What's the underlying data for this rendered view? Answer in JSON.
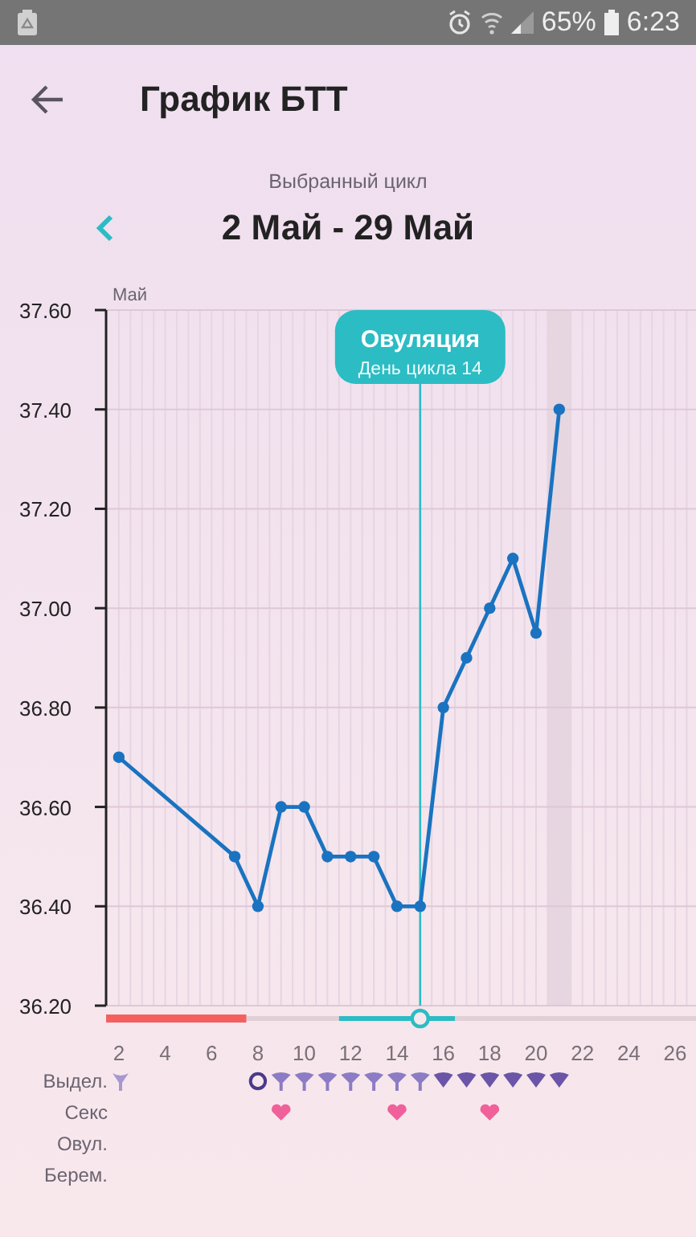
{
  "status_bar": {
    "battery": "65%",
    "time": "6:23"
  },
  "header": {
    "title": "График БТТ"
  },
  "cycle": {
    "caption": "Выбранный цикл",
    "range": "2 Май - 29 Май"
  },
  "chart": {
    "month_label": "Май",
    "ovulation_bubble": {
      "title": "Овуляция",
      "subtitle": "День цикла 14"
    },
    "chart_data": {
      "type": "line",
      "grid": true,
      "x": [
        2,
        7,
        8,
        9,
        10,
        11,
        12,
        13,
        14,
        15,
        16,
        17,
        18,
        19,
        20,
        21
      ],
      "series": [
        {
          "color": "#1a73c0",
          "marker": "o",
          "values": [
            36.7,
            36.5,
            36.4,
            36.6,
            36.6,
            36.5,
            36.5,
            36.5,
            36.4,
            36.4,
            36.8,
            36.9,
            37.0,
            37.1,
            36.95,
            37.4
          ]
        }
      ],
      "xlim": [
        1.45,
        26.9
      ],
      "ylim": [
        36.2,
        37.6
      ],
      "xticks": [
        2,
        4,
        6,
        8,
        10,
        12,
        14,
        16,
        18,
        20,
        22,
        24,
        26
      ],
      "yticks": [
        {
          "value": 36.2,
          "label": "36.20"
        },
        {
          "value": 36.4,
          "label": "36.40"
        },
        {
          "value": 36.6,
          "label": "36.60"
        },
        {
          "value": 36.8,
          "label": "36.80"
        },
        {
          "value": 37.0,
          "label": "37.00"
        },
        {
          "value": 37.2,
          "label": "37.20"
        },
        {
          "value": 37.4,
          "label": "37.40"
        },
        {
          "value": 37.6,
          "label": "37.60"
        }
      ],
      "ref_lines": [
        {
          "axis": "x",
          "value": 15,
          "color": "#2cbcc4"
        }
      ],
      "bands": [
        {
          "axis": "x",
          "from": 20.5,
          "to": 21.5,
          "color": "#e6d6e0"
        }
      ]
    },
    "phase_bar": [
      {
        "kind": "period"
      },
      {
        "kind": "period"
      },
      {
        "kind": "period"
      },
      {
        "kind": "period"
      },
      {
        "kind": "period"
      },
      {
        "kind": "period"
      },
      {
        "kind": "none"
      },
      {
        "kind": "none"
      },
      {
        "kind": "none"
      },
      {
        "kind": "none"
      },
      {
        "kind": "fertile"
      },
      {
        "kind": "fertile"
      },
      {
        "kind": "fertile"
      },
      {
        "kind": "fertile"
      },
      {
        "kind": "fertile"
      },
      {
        "kind": "none"
      },
      {
        "kind": "none"
      },
      {
        "kind": "none"
      },
      {
        "kind": "none"
      },
      {
        "kind": "none"
      },
      {
        "kind": "none"
      },
      {
        "kind": "none"
      },
      {
        "kind": "none"
      },
      {
        "kind": "none"
      },
      {
        "kind": "none"
      }
    ]
  },
  "rows": [
    {
      "kind": "discharge",
      "label": "Выдел.",
      "cells": [
        {
          "kind": "none"
        },
        {
          "kind": "none"
        },
        {
          "kind": "none"
        },
        {
          "kind": "none"
        },
        {
          "kind": "none"
        },
        {
          "kind": "none"
        },
        {
          "kind": "circle"
        },
        {
          "kind": "light"
        },
        {
          "kind": "light"
        },
        {
          "kind": "light"
        },
        {
          "kind": "light"
        },
        {
          "kind": "light"
        },
        {
          "kind": "light"
        },
        {
          "kind": "light"
        },
        {
          "kind": "heavy"
        },
        {
          "kind": "heavy"
        },
        {
          "kind": "heavy"
        },
        {
          "kind": "heavy"
        },
        {
          "kind": "heavy"
        },
        {
          "kind": "heavy"
        }
      ]
    },
    {
      "kind": "sex",
      "label": "Секс",
      "cells": [
        {
          "kind": "none"
        },
        {
          "kind": "none"
        },
        {
          "kind": "none"
        },
        {
          "kind": "none"
        },
        {
          "kind": "none"
        },
        {
          "kind": "none"
        },
        {
          "kind": "none"
        },
        {
          "kind": "heart"
        },
        {
          "kind": "none"
        },
        {
          "kind": "none"
        },
        {
          "kind": "none"
        },
        {
          "kind": "none"
        },
        {
          "kind": "heart"
        },
        {
          "kind": "none"
        },
        {
          "kind": "none"
        },
        {
          "kind": "none"
        },
        {
          "kind": "heart"
        }
      ]
    },
    {
      "kind": "ovulation",
      "label": "Овул."
    },
    {
      "kind": "pregnancy",
      "label": "Берем."
    }
  ]
}
